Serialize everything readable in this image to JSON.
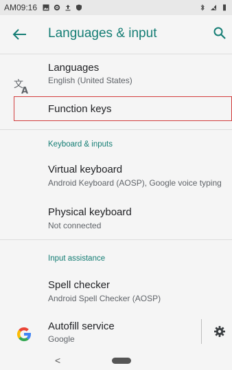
{
  "status_bar": {
    "time": "AM09:16",
    "icons_left": [
      "image-icon",
      "settings-icon",
      "upload-icon",
      "shield-icon"
    ],
    "icons_right": [
      "bluetooth-icon",
      "no-signal-icon",
      "battery-icon"
    ]
  },
  "toolbar": {
    "title": "Languages & input",
    "back_icon": "back-arrow-icon",
    "search_icon": "search-icon"
  },
  "items": {
    "languages": {
      "title": "Languages",
      "subtitle": "English (United States)",
      "icon": "translate-icon"
    },
    "function_keys": {
      "title": "Function keys"
    },
    "keyboard_section": {
      "label": "Keyboard & inputs"
    },
    "virtual_keyboard": {
      "title": "Virtual keyboard",
      "subtitle": "Android Keyboard (AOSP), Google voice typing"
    },
    "physical_keyboard": {
      "title": "Physical keyboard",
      "subtitle": "Not connected"
    },
    "input_assistance_section": {
      "label": "Input assistance"
    },
    "spell_checker": {
      "title": "Spell checker",
      "subtitle": "Android Spell Checker (AOSP)"
    },
    "autofill_service": {
      "title": "Autofill service",
      "subtitle": "Google",
      "icon": "google-g-icon",
      "settings_icon": "gear-icon"
    }
  },
  "nav_bar": {
    "back_glyph": "<"
  },
  "colors": {
    "accent": "#147d74",
    "highlight_border": "#d23c3c"
  }
}
